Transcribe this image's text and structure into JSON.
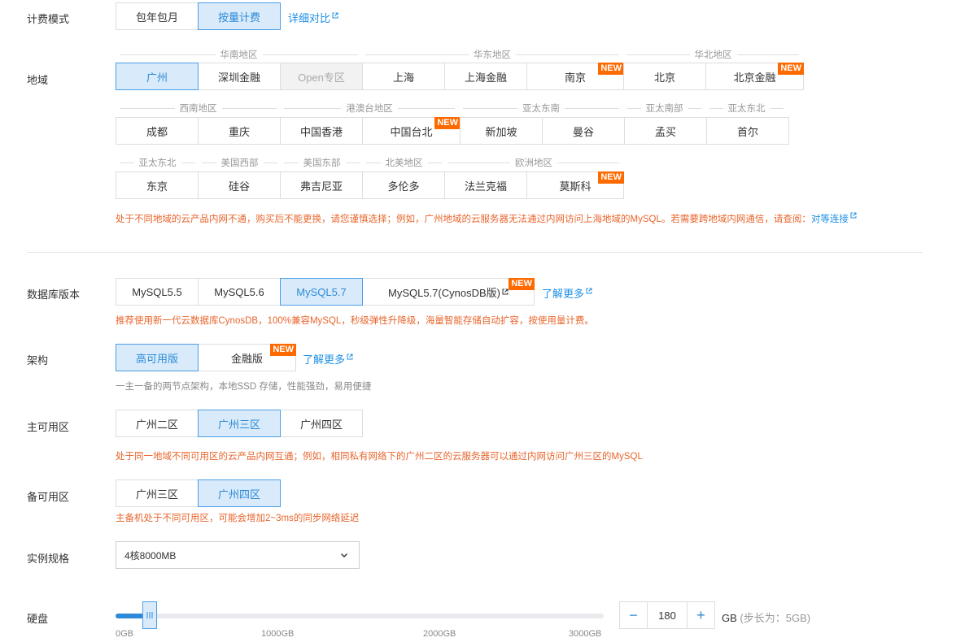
{
  "billing": {
    "label": "计费模式",
    "options": [
      "包年包月",
      "按量计费"
    ],
    "compare_link": "详细对比"
  },
  "region": {
    "label": "地域",
    "group_labels": {
      "south_china": "华南地区",
      "east_china": "华东地区",
      "north_china": "华北地区",
      "southwest": "西南地区",
      "hk_macao_tw": "港澳台地区",
      "southeast_asia": "亚太东南",
      "south_asia": "亚太南部",
      "northeast_asia_1": "亚太东北",
      "northeast_asia_2": "亚太东北",
      "us_west": "美国西部",
      "us_east": "美国东部",
      "north_america": "北美地区",
      "europe": "欧洲地区"
    },
    "row1": [
      "广州",
      "深圳金融",
      "Open专区",
      "上海",
      "上海金融",
      "南京",
      "北京",
      "北京金融"
    ],
    "row2": [
      "成都",
      "重庆",
      "中国香港",
      "中国台北",
      "新加坡",
      "曼谷",
      "孟买",
      "首尔"
    ],
    "row3": [
      "东京",
      "硅谷",
      "弗吉尼亚",
      "多伦多",
      "法兰克福",
      "莫斯科"
    ],
    "new_badge": "NEW",
    "note": "处于不同地域的云产品内网不通，购买后不能更换，请您谨慎选择；例如，广州地域的云服务器无法通过内网访问上海地域的MySQL。若需要跨地域内网通信，请查阅：",
    "note_link": "对等连接"
  },
  "db_version": {
    "label": "数据库版本",
    "options": [
      "MySQL5.5",
      "MySQL5.6",
      "MySQL5.7",
      "MySQL5.7(CynosDB版)"
    ],
    "learn_more": "了解更多",
    "note": "推荐使用新一代云数据库CynosDB，100%兼容MySQL，秒级弹性升降级，海量智能存储自动扩容，按使用量计费。"
  },
  "architecture": {
    "label": "架构",
    "options": [
      "高可用版",
      "金融版"
    ],
    "learn_more": "了解更多",
    "note": "一主一备的两节点架构，本地SSD 存储，性能强劲，易用便捷"
  },
  "primary_zone": {
    "label": "主可用区",
    "options": [
      "广州二区",
      "广州三区",
      "广州四区"
    ],
    "note": "处于同一地域不同可用区的云产品内网互通；例如，相同私有网络下的广州二区的云服务器可以通过内网访问广州三区的MySQL"
  },
  "backup_zone": {
    "label": "备可用区",
    "options": [
      "广州三区",
      "广州四区"
    ],
    "note": "主备机处于不同可用区，可能会增加2~3ms的同步网络延迟"
  },
  "instance_spec": {
    "label": "实例规格",
    "value": "4核8000MB"
  },
  "disk": {
    "label": "硬盘",
    "ticks": [
      "0GB",
      "1000GB",
      "2000GB",
      "3000GB"
    ],
    "value": "180",
    "slider_fraction": 0.06,
    "minus": "−",
    "plus": "+",
    "unit": "GB",
    "step_text": "(步长为：5GB)"
  },
  "colors": {
    "accent": "#2c8ad6",
    "selected_bg": "#d9ebfb",
    "warning_text": "#e8652c",
    "new_badge": "#ff6a00"
  }
}
